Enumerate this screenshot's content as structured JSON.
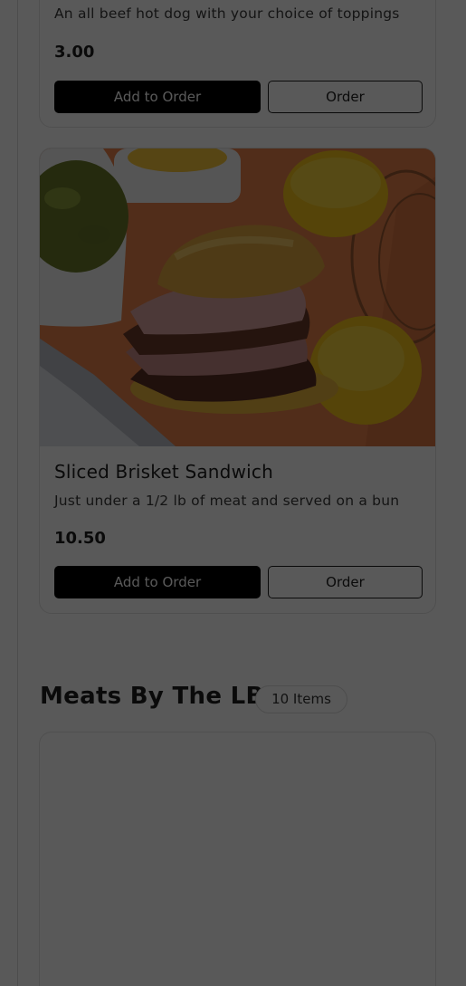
{
  "items": [
    {
      "description": "An all beef hot dog with your choice of toppings",
      "price": "3.00",
      "add_label": "Add to Order",
      "order_label": "Order"
    },
    {
      "title": "Sliced Brisket Sandwich",
      "description": "Just under a 1/2 lb of meat and served on a bun",
      "price": "10.50",
      "add_label": "Add to Order",
      "order_label": "Order",
      "image_icon": "brisket-sandwich-photo"
    }
  ],
  "section": {
    "title": "Meats By The LB",
    "count": "10 Items"
  },
  "colors": {
    "overlay": "rgba(0,0,0,0.65)",
    "button_primary": "#000000",
    "tray": "#e8804a",
    "cornbread": "#f2c21c",
    "greens": "#6b7a2a"
  }
}
